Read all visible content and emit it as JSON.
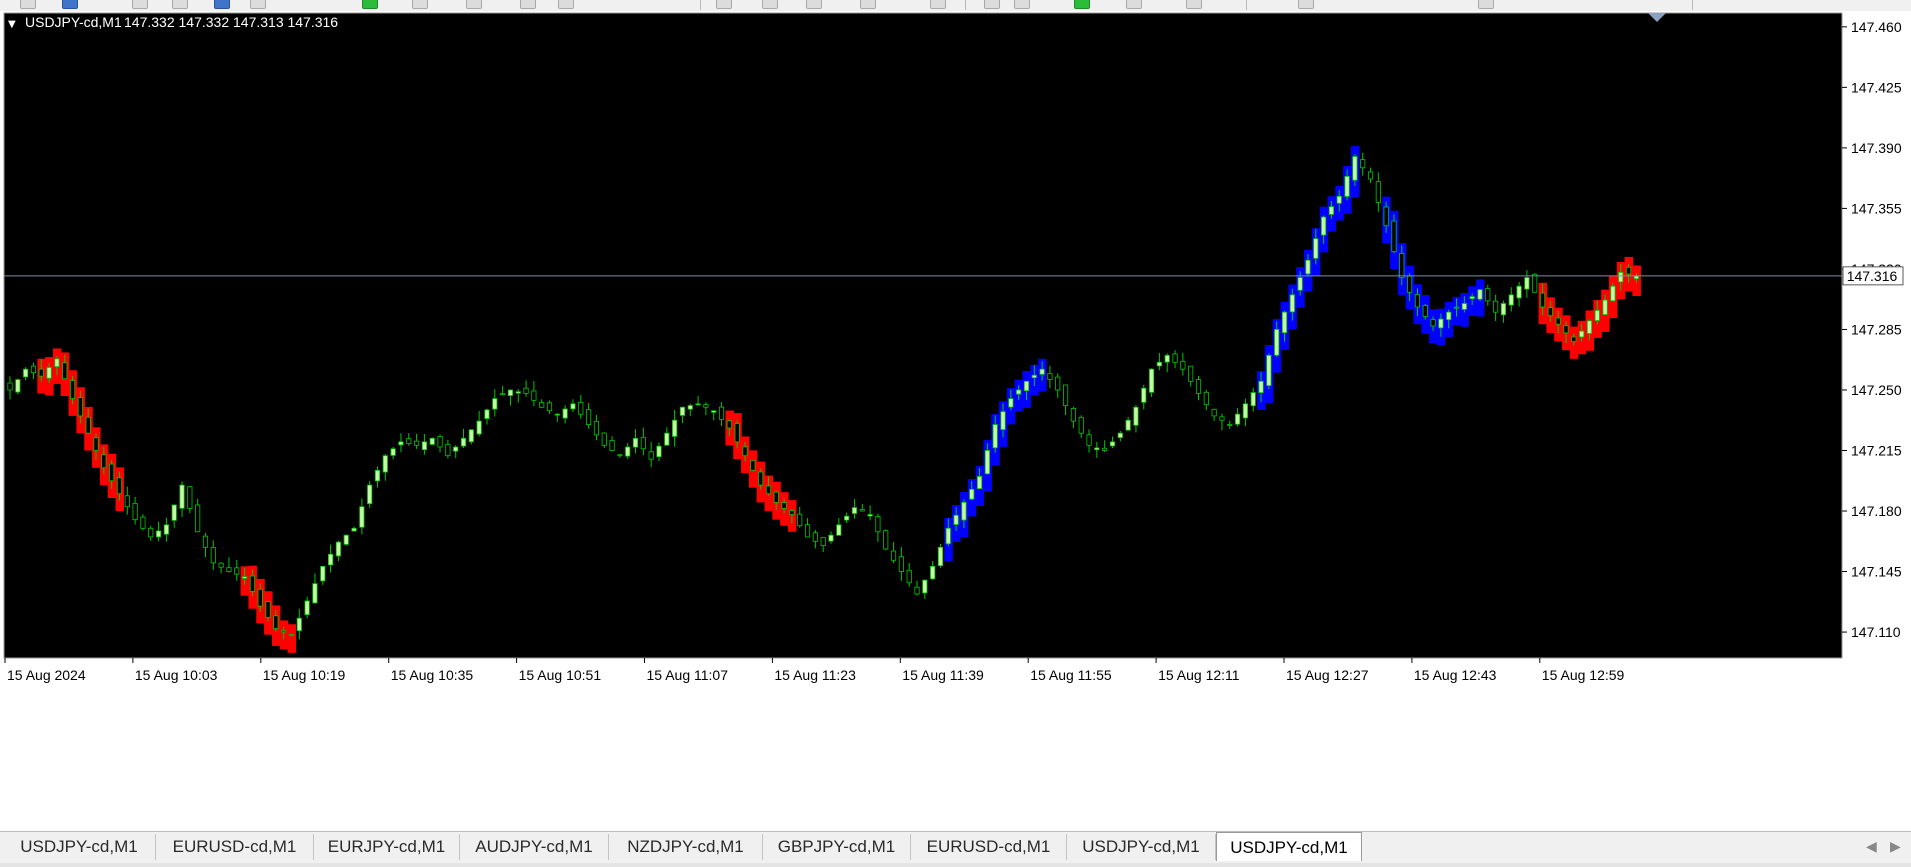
{
  "chart_data": {
    "type": "candlestick",
    "title": "USDJPY-cd,M1",
    "header_values": "147.332 147.332 147.313 147.316",
    "ylim": [
      147.095,
      147.468
    ],
    "y_ticks": [
      147.46,
      147.425,
      147.39,
      147.355,
      147.32,
      147.285,
      147.25,
      147.215,
      147.18,
      147.145,
      147.11
    ],
    "x_ticks": [
      "15 Aug 2024",
      "15 Aug 10:03",
      "15 Aug 10:19",
      "15 Aug 10:35",
      "15 Aug 10:51",
      "15 Aug 11:07",
      "15 Aug 11:23",
      "15 Aug 11:39",
      "15 Aug 11:55",
      "15 Aug 12:11",
      "15 Aug 12:27",
      "15 Aug 12:43",
      "15 Aug 12:59"
    ],
    "current_price": 147.316,
    "price_line_color": "#7a8ea3",
    "background_color": "#000000",
    "grid": false,
    "up_candle_color": "#c8f5a8",
    "wick_color": "#00c800",
    "x_range": [
      0,
      210
    ],
    "up_fill_color": "#0000ff",
    "down_fill_color": "#ff0000",
    "close_path": [
      [
        0,
        147.25
      ],
      [
        2,
        147.262
      ],
      [
        4,
        147.258
      ],
      [
        6,
        147.268
      ],
      [
        8,
        147.245
      ],
      [
        10,
        147.225
      ],
      [
        12,
        147.205
      ],
      [
        14,
        147.19
      ],
      [
        16,
        147.175
      ],
      [
        18,
        147.165
      ],
      [
        20,
        147.172
      ],
      [
        22,
        147.195
      ],
      [
        24,
        147.168
      ],
      [
        26,
        147.15
      ],
      [
        28,
        147.145
      ],
      [
        30,
        147.142
      ],
      [
        32,
        147.125
      ],
      [
        34,
        147.112
      ],
      [
        36,
        147.108
      ],
      [
        38,
        147.128
      ],
      [
        40,
        147.148
      ],
      [
        42,
        147.162
      ],
      [
        44,
        147.17
      ],
      [
        46,
        147.195
      ],
      [
        48,
        147.212
      ],
      [
        50,
        147.22
      ],
      [
        52,
        147.218
      ],
      [
        54,
        147.222
      ],
      [
        56,
        147.212
      ],
      [
        58,
        147.222
      ],
      [
        60,
        147.232
      ],
      [
        62,
        147.245
      ],
      [
        64,
        147.25
      ],
      [
        66,
        147.248
      ],
      [
        68,
        147.24
      ],
      [
        70,
        147.236
      ],
      [
        72,
        147.242
      ],
      [
        74,
        147.23
      ],
      [
        76,
        147.218
      ],
      [
        78,
        147.212
      ],
      [
        80,
        147.222
      ],
      [
        82,
        147.21
      ],
      [
        84,
        147.225
      ],
      [
        86,
        147.24
      ],
      [
        88,
        147.242
      ],
      [
        90,
        147.238
      ],
      [
        92,
        147.228
      ],
      [
        94,
        147.212
      ],
      [
        96,
        147.195
      ],
      [
        98,
        147.185
      ],
      [
        100,
        147.178
      ],
      [
        102,
        147.165
      ],
      [
        104,
        147.16
      ],
      [
        106,
        147.172
      ],
      [
        108,
        147.182
      ],
      [
        110,
        147.178
      ],
      [
        112,
        147.158
      ],
      [
        114,
        147.145
      ],
      [
        116,
        147.132
      ],
      [
        118,
        147.148
      ],
      [
        120,
        147.17
      ],
      [
        122,
        147.185
      ],
      [
        124,
        147.2
      ],
      [
        126,
        147.23
      ],
      [
        128,
        147.245
      ],
      [
        130,
        147.255
      ],
      [
        132,
        147.262
      ],
      [
        134,
        147.25
      ],
      [
        136,
        147.232
      ],
      [
        138,
        147.218
      ],
      [
        140,
        147.215
      ],
      [
        142,
        147.225
      ],
      [
        144,
        147.24
      ],
      [
        146,
        147.262
      ],
      [
        148,
        147.27
      ],
      [
        150,
        147.262
      ],
      [
        152,
        147.248
      ],
      [
        154,
        147.235
      ],
      [
        156,
        147.23
      ],
      [
        158,
        147.242
      ],
      [
        160,
        147.255
      ],
      [
        162,
        147.285
      ],
      [
        164,
        147.305
      ],
      [
        166,
        147.325
      ],
      [
        168,
        147.35
      ],
      [
        170,
        147.362
      ],
      [
        172,
        147.385
      ],
      [
        174,
        147.372
      ],
      [
        176,
        147.345
      ],
      [
        178,
        147.315
      ],
      [
        180,
        147.298
      ],
      [
        182,
        147.287
      ],
      [
        184,
        147.295
      ],
      [
        186,
        147.3
      ],
      [
        188,
        147.308
      ],
      [
        190,
        147.295
      ],
      [
        192,
        147.305
      ],
      [
        194,
        147.315
      ],
      [
        196,
        147.298
      ],
      [
        198,
        147.288
      ],
      [
        200,
        147.278
      ],
      [
        202,
        147.29
      ],
      [
        204,
        147.302
      ],
      [
        206,
        147.318
      ],
      [
        208,
        147.316
      ]
    ]
  },
  "tabs": [
    {
      "label": "USDJPY-cd,M1"
    },
    {
      "label": "EURUSD-cd,M1"
    },
    {
      "label": "EURJPY-cd,M1"
    },
    {
      "label": "AUDJPY-cd,M1"
    },
    {
      "label": "NZDJPY-cd,M1"
    },
    {
      "label": "GBPJPY-cd,M1"
    },
    {
      "label": "EURUSD-cd,M1"
    },
    {
      "label": "USDJPY-cd,M1"
    },
    {
      "label": "USDJPY-cd,M1"
    }
  ],
  "active_tab_index": 8
}
